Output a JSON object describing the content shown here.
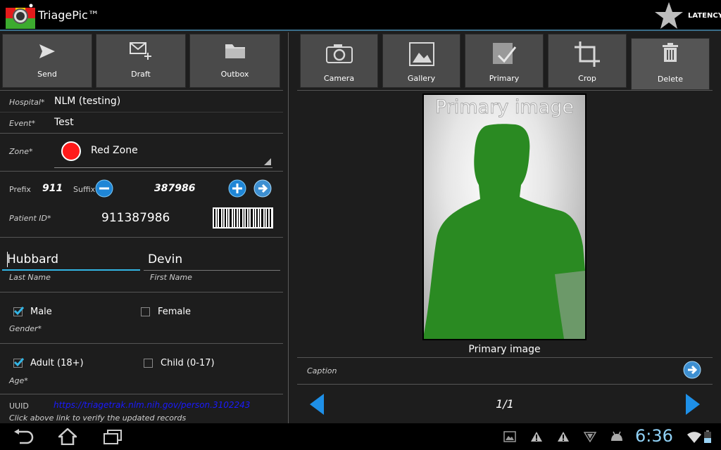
{
  "app": {
    "title": "TriagePic™",
    "latency_label": "LATENCY"
  },
  "left_toolbar": {
    "send": "Send",
    "draft": "Draft",
    "outbox": "Outbox"
  },
  "form": {
    "hospital_label": "Hospital*",
    "hospital_value": "NLM (testing)",
    "event_label": "Event*",
    "event_value": "Test",
    "zone_label": "Zone*",
    "zone_value": "Red Zone",
    "zone_color": "#ff1a1a",
    "prefix_label": "Prefix",
    "prefix_value": "911",
    "suffix_label": "Suffix",
    "suffix_value": "387986",
    "patient_id_label": "Patient ID*",
    "patient_id_value": "911387986",
    "last_name_value": "Hubbard",
    "last_name_label": "Last Name",
    "first_name_value": "Devin",
    "first_name_label": "First Name",
    "gender_male": "Male",
    "gender_female": "Female",
    "gender_label": "Gender*",
    "gender_male_checked": true,
    "gender_female_checked": false,
    "age_adult": "Adult (18+)",
    "age_child": "Child (0-17)",
    "age_label": "Age*",
    "age_adult_checked": true,
    "age_child_checked": false,
    "uuid_label": "UUID",
    "uuid_link": "https://triagetrak.nlm.nih.gov/person.3102243",
    "uuid_hint": "Click above link to verify the updated records"
  },
  "right_toolbar": {
    "camera": "Camera",
    "gallery": "Gallery",
    "primary": "Primary",
    "crop": "Crop",
    "delete": "Delete"
  },
  "image_panel": {
    "overlay_text": "Primary image",
    "image_label": "Primary image",
    "caption_label": "Caption",
    "page_indicator": "1/1"
  },
  "system_bar": {
    "time": "6:36"
  },
  "colors": {
    "accent": "#33b5e5",
    "silhouette": "#2a8a22",
    "link": "#1a1aff"
  },
  "icons": [
    "send-icon",
    "draft-icon",
    "outbox-icon",
    "camera-icon",
    "gallery-icon",
    "primary-icon",
    "crop-icon",
    "delete-icon",
    "minus-icon",
    "plus-icon",
    "next-arrow-icon",
    "barcode-icon",
    "back-icon",
    "home-icon",
    "recent-apps-icon"
  ]
}
